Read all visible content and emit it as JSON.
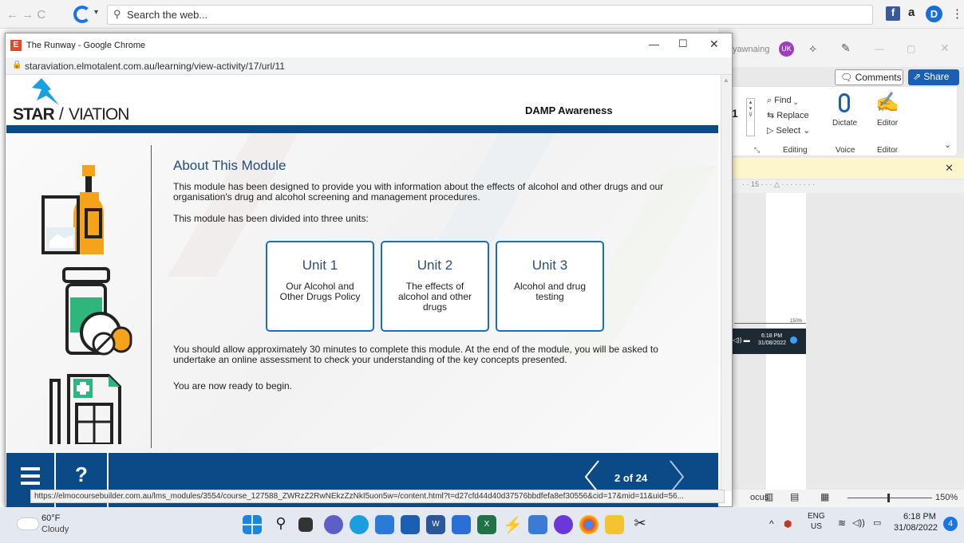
{
  "bg_browser": {
    "search_placeholder": "Search the web...",
    "nav_glyphs": "← → C"
  },
  "word": {
    "user_fragment": "yawnaing",
    "avatar_initials": "UK",
    "comments_label": "Comments",
    "share_label": "Share",
    "font_size_fragment": "1",
    "find_label": "Find",
    "replace_label": "Replace",
    "select_label": "Select",
    "editing_group": "Editing",
    "dictate_label": "Dictate",
    "voice_group": "Voice",
    "editor_label": "Editor",
    "editor_group": "Editor",
    "ruler_text": "· · 15 · · · △ · · · · · · · ·",
    "mini_time": "6:18 PM",
    "mini_date": "31/08/2022",
    "mini_zoom": "150%",
    "focus_label": "ocus",
    "zoom_label": "150%"
  },
  "popup": {
    "title": "The Runway - Google Chrome",
    "url": "staraviation.elmotalent.com.au/learning/view-activity/17/url/11"
  },
  "course": {
    "brand_left": "STAR",
    "brand_right": "VIATION",
    "module_name": "DAMP Awareness",
    "heading": "About This Module",
    "intro": "This module has been designed to provide you with information about the effects of alcohol and other drugs and our organisation's drug and alcohol screening and management procedures.",
    "divided": "This module has been divided into three units:",
    "units": [
      {
        "title": "Unit 1",
        "desc": "Our Alcohol and Other Drugs Policy"
      },
      {
        "title": "Unit 2",
        "desc": "The effects of alcohol and other drugs"
      },
      {
        "title": "Unit 3",
        "desc": "Alcohol and drug testing"
      }
    ],
    "time_note": "You should allow approximately 30 minutes to complete this module. At the end of the module, you will be asked to undertake an online assessment to check your understanding of the key concepts presented.",
    "ready": "You are now ready to begin.",
    "page_indicator": "2 of 24",
    "help_glyph": "?"
  },
  "status_url": "https://elmocoursebuilder.com.au/lms_modules/3554/course_127588_ZWRzZ2RwNEkzZzNkI5uon5w=/content.html?t=d27cfd44d40d37576bbdfefa8ef30556&cid=17&mid=11&uid=56...",
  "taskbar": {
    "temp": "60°F",
    "weather": "Cloudy",
    "lang1": "ENG",
    "lang2": "US",
    "time": "6:18 PM",
    "date": "31/08/2022",
    "notif_count": "4"
  },
  "colors": {
    "course_blue": "#0b4a86",
    "unit_border": "#1b6fb8",
    "pill_orange": "#f4a31a",
    "pill_green": "#2fb67c"
  }
}
